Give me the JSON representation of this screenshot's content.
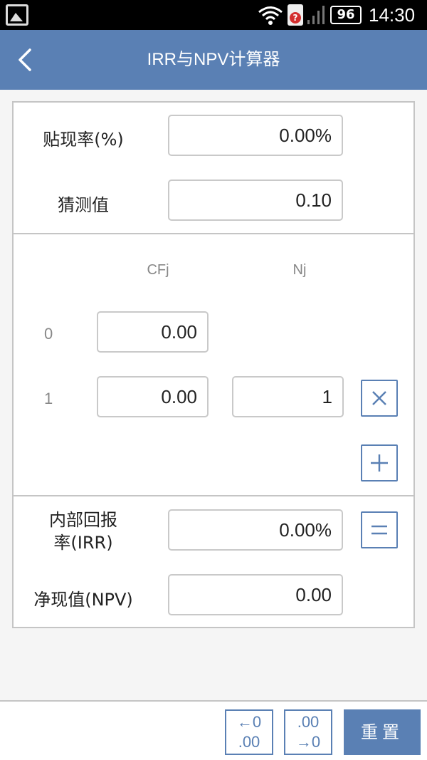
{
  "status_bar": {
    "battery": "96",
    "time": "14:30",
    "icons": [
      "gallery-icon",
      "wifi-icon",
      "sim-alert-icon",
      "signal-icon",
      "battery-icon"
    ]
  },
  "header": {
    "title": "IRR与NPV计算器",
    "back_icon": "chevron-left-icon"
  },
  "inputs": {
    "discount_rate_label": "贴现率(%)",
    "discount_rate_value": "0.00%",
    "guess_label": "猜测值",
    "guess_value": "0.10"
  },
  "cash_flows": {
    "col_cf": "CFj",
    "col_n": "Nj",
    "rows": [
      {
        "index": "0",
        "cf": "0.00"
      },
      {
        "index": "1",
        "cf": "0.00",
        "n": "1"
      }
    ],
    "remove_icon": "close-icon",
    "add_icon": "plus-icon"
  },
  "results": {
    "irr_label_line1": "内部回报",
    "irr_label_line2": "率(IRR)",
    "irr_value": "0.00%",
    "equals_icon": "equals-icon",
    "npv_label": "净现值(NPV)",
    "npv_value": "0.00"
  },
  "bottom_bar": {
    "decrease_top": "←0",
    "decrease_bottom": ".00",
    "increase_top": ".00",
    "increase_bottom": "→0",
    "reset_label": "重置"
  },
  "colors": {
    "accent": "#5a80b4",
    "border": "#c5c5c5"
  }
}
